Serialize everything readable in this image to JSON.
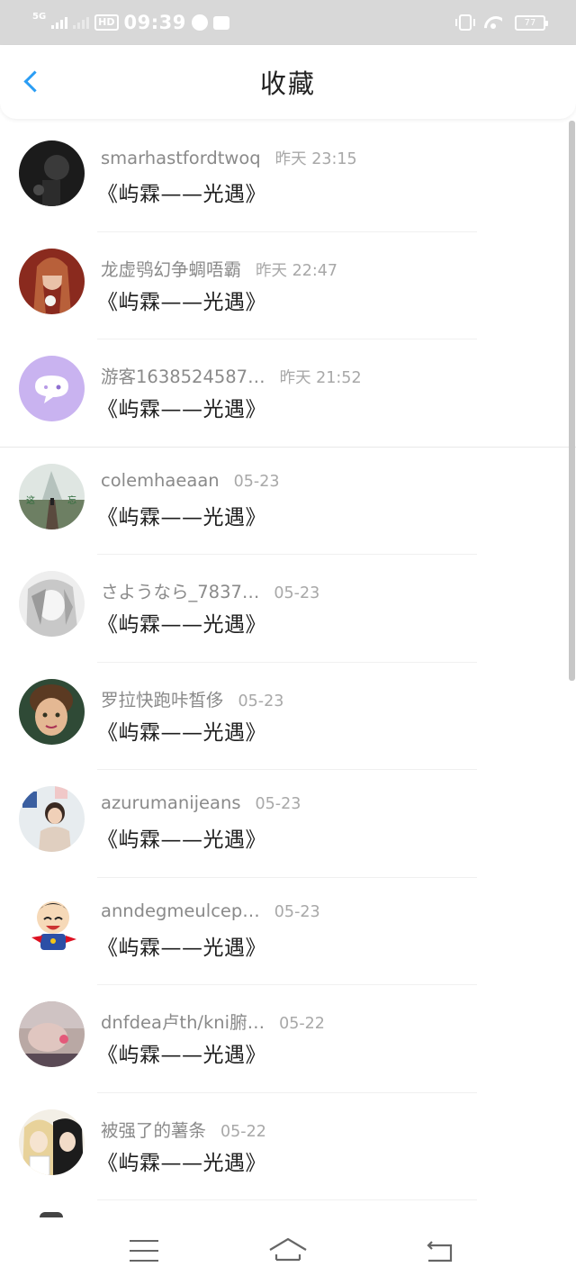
{
  "status_bar": {
    "network": "5G",
    "hd": "HD",
    "time": "09:39",
    "battery": "77"
  },
  "header": {
    "title": "收藏"
  },
  "items": [
    {
      "username": "smarhastfordtwoq",
      "time": "昨天 23:15",
      "book": "《屿霖——光遇》"
    },
    {
      "username": "龙虚鸮幻争蜩唔霸",
      "time": "昨天 22:47",
      "book": "《屿霖——光遇》"
    },
    {
      "username": "游客1638524587…",
      "time": "昨天 21:52",
      "book": "《屿霖——光遇》"
    },
    {
      "username": "colemhaeaan",
      "time": "05-23",
      "book": "《屿霖——光遇》"
    },
    {
      "username": "さようなら_7837…",
      "time": "05-23",
      "book": "《屿霖——光遇》"
    },
    {
      "username": "罗拉快跑咔皙侈",
      "time": "05-23",
      "book": "《屿霖——光遇》"
    },
    {
      "username": "azurumanijeans",
      "time": "05-23",
      "book": "《屿霖——光遇》"
    },
    {
      "username": "anndegmeulcep…",
      "time": "05-23",
      "book": "《屿霖——光遇》"
    },
    {
      "username": "dnfdea卢th/kni腑…",
      "time": "05-22",
      "book": "《屿霖——光遇》"
    },
    {
      "username": "被强了的薯条",
      "time": "05-22",
      "book": "《屿霖——光遇》"
    }
  ],
  "colors": {
    "accent": "#2a9df4",
    "username": "#8a8a8a",
    "time": "#a8a8a8",
    "book": "#1e1e1e",
    "status_bar_bg": "#d8d8d8"
  },
  "icons": {
    "back": "chevron-left-icon",
    "nav_menu": "menu-icon",
    "nav_home": "home-icon",
    "nav_back": "return-icon"
  }
}
